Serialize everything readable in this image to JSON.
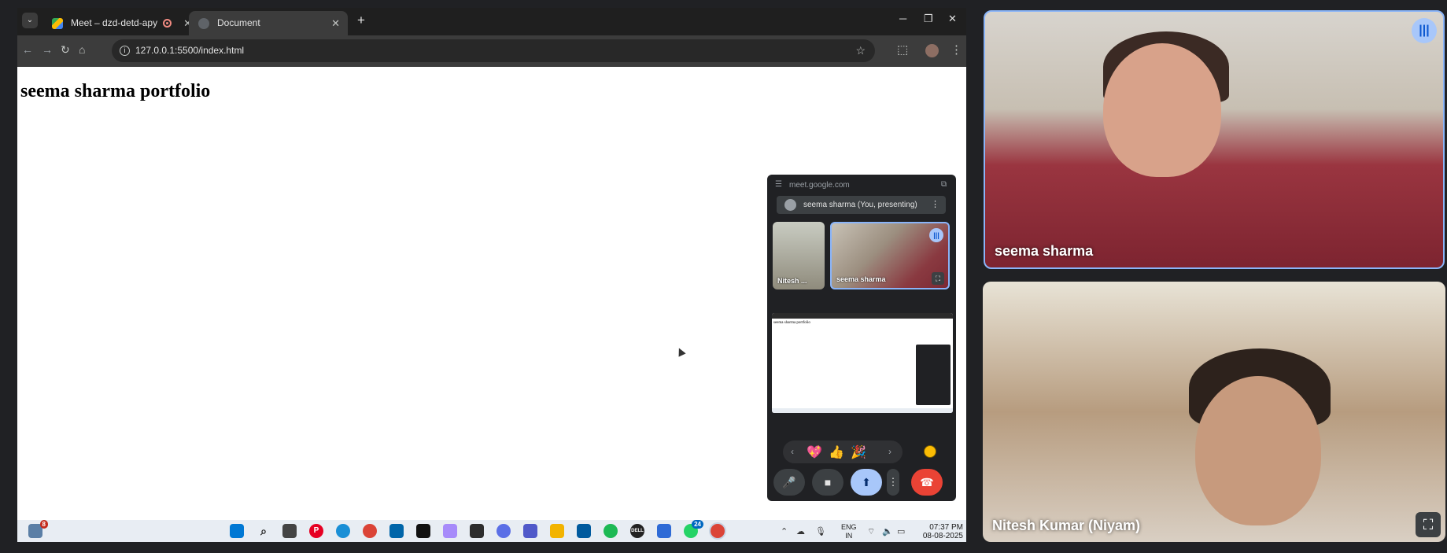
{
  "browser": {
    "tabs": [
      {
        "title": "Meet – dzd-detd-apy",
        "recording": true
      },
      {
        "title": "Document",
        "active": true
      }
    ],
    "url": "127.0.0.1:5500/index.html",
    "page_heading": "seema sharma portfolio"
  },
  "pip": {
    "origin": "meet.google.com",
    "presenter_label": "seema sharma (You, presenting)",
    "tiles": [
      {
        "name": "Nitesh ..."
      },
      {
        "name": "seema sharma",
        "speaking": true
      }
    ],
    "reactions": [
      "💖",
      "👍",
      "🎉"
    ],
    "controls": [
      "mic-icon",
      "camera-icon",
      "present-icon",
      "more-icon",
      "end-call-icon"
    ]
  },
  "videos": [
    {
      "name": "seema sharma",
      "speaking": true
    },
    {
      "name": "Nitesh Kumar (Niyam)"
    }
  ],
  "taskbar": {
    "notification_badge": "8",
    "whatsapp_badge": "24",
    "language": "ENG",
    "region": "IN",
    "time": "07:37 PM",
    "date": "08-08-2025"
  },
  "colors": {
    "accent": "#8ab4f8",
    "end_call": "#ea4335",
    "present_active": "#a8c7fa"
  }
}
